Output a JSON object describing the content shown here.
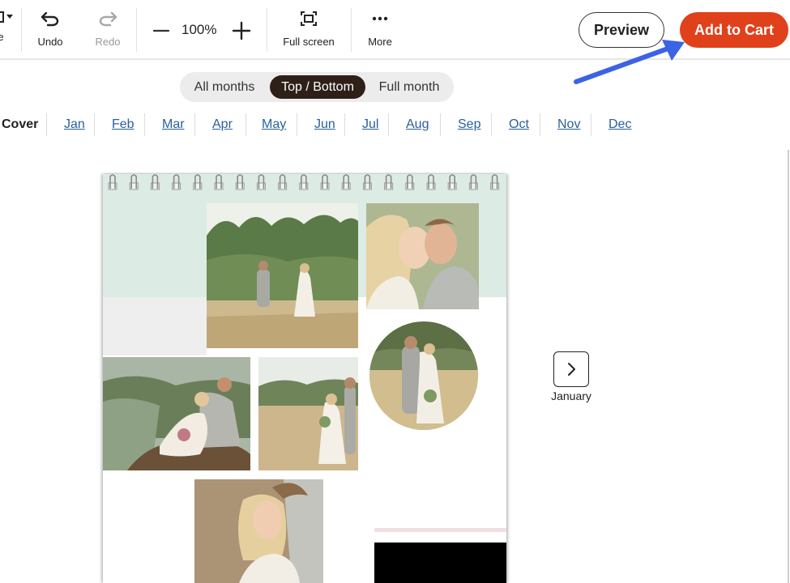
{
  "toolbar": {
    "partial_label": "e",
    "undo_label": "Undo",
    "redo_label": "Redo",
    "zoom_value": "100%",
    "fullscreen_label": "Full screen",
    "more_label": "More",
    "preview_label": "Preview",
    "add_to_cart_label": "Add to Cart"
  },
  "view_toggle": {
    "options": [
      "All months",
      "Top / Bottom",
      "Full month"
    ],
    "selected": "Top / Bottom"
  },
  "month_nav": {
    "cover": "Cover",
    "months": [
      "Jan",
      "Feb",
      "Mar",
      "Apr",
      "May",
      "Jun",
      "Jul",
      "Aug",
      "Sep",
      "Oct",
      "Nov",
      "Dec"
    ]
  },
  "next_page": {
    "label": "January"
  },
  "colors": {
    "accent_cart": "#e0411b",
    "toggle_active": "#2e2019",
    "link": "#2a5f9e",
    "mint_background": "#dcece5",
    "annotation_arrow": "#3b63e6"
  },
  "icons": {
    "undo": "undo-icon",
    "redo": "redo-icon",
    "zoom_out": "minus-icon",
    "zoom_in": "plus-icon",
    "fullscreen": "fullscreen-icon",
    "more": "more-dots-icon",
    "next": "chevron-right-icon"
  }
}
